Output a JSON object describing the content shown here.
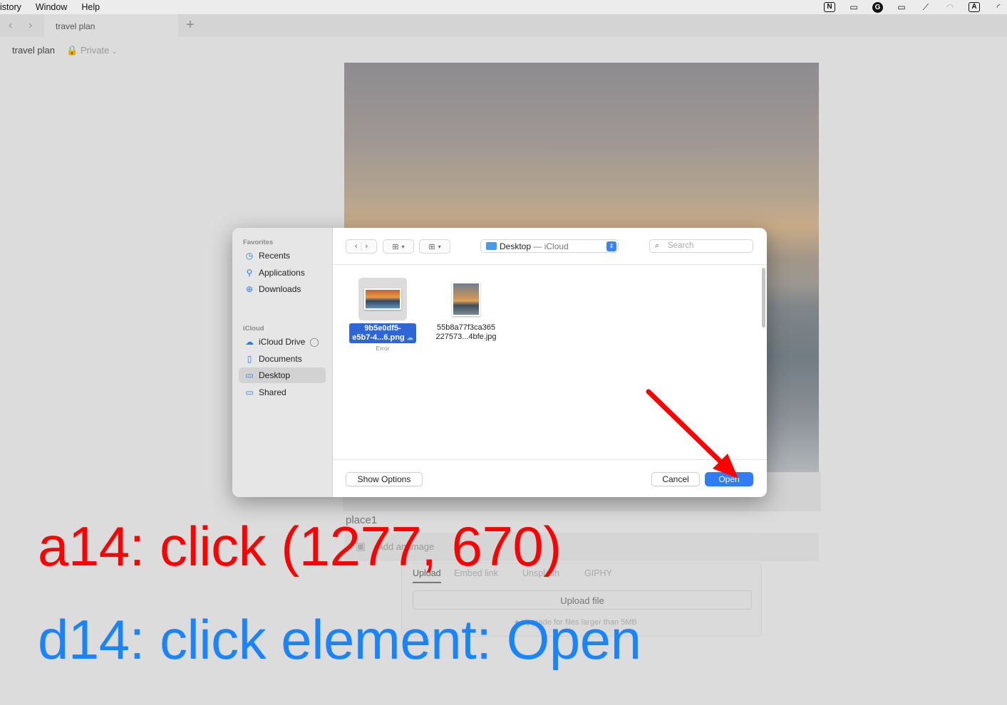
{
  "menubar": {
    "items": [
      "istory",
      "Window",
      "Help"
    ],
    "tray_icons": [
      "N",
      "zoom-icon",
      "grammarly-icon",
      "display-icon",
      "pen-off-icon",
      "airdrop-icon",
      "A",
      "wifi-icon"
    ]
  },
  "browser": {
    "tab_title": "travel plan",
    "page_title": "travel plan",
    "privacy": "Private"
  },
  "page": {
    "place_label": "place1",
    "add_image_label": "Add an image",
    "upload_tabs": [
      "Upload",
      "Embed link",
      "Unsplash",
      "GIPHY"
    ],
    "upload_button": "Upload file",
    "upload_note": "Upgrade for files larger than 5MB"
  },
  "dialog": {
    "sidebar": {
      "favorites_heading": "Favorites",
      "favorites": [
        {
          "label": "Recents",
          "icon": "clock-icon"
        },
        {
          "label": "Applications",
          "icon": "applications-icon"
        },
        {
          "label": "Downloads",
          "icon": "download-icon"
        }
      ],
      "icloud_heading": "iCloud",
      "icloud": [
        {
          "label": "iCloud Drive",
          "icon": "cloud-icon"
        },
        {
          "label": "Documents",
          "icon": "document-icon"
        },
        {
          "label": "Desktop",
          "icon": "desktop-icon",
          "selected": true
        },
        {
          "label": "Shared",
          "icon": "shared-folder-icon"
        }
      ]
    },
    "location": {
      "name": "Desktop",
      "suffix": " — iCloud"
    },
    "search_placeholder": "Search",
    "files": [
      {
        "line1": "9b5e0df5-",
        "line2": "e5b7-4...6.png",
        "status": "Error",
        "selected": true
      },
      {
        "line1": "55b8a77f3ca365",
        "line2": "227573...4bfe.jpg",
        "selected": false
      }
    ],
    "buttons": {
      "show_options": "Show Options",
      "cancel": "Cancel",
      "open": "Open"
    }
  },
  "annotations": {
    "action": "a14: click (1277, 670)",
    "description": "d14: click element: Open",
    "arrow_color": "#ff0000"
  }
}
